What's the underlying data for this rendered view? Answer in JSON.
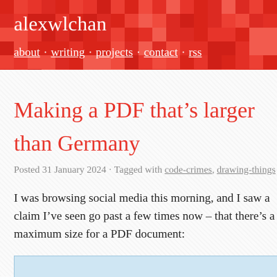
{
  "header": {
    "site_title": "alexwlchan",
    "nav": [
      {
        "label": "about"
      },
      {
        "label": "writing"
      },
      {
        "label": "projects"
      },
      {
        "label": "contact"
      },
      {
        "label": "rss"
      }
    ],
    "separator": "·",
    "accent_color": "#e7342a"
  },
  "post": {
    "title": "Making a PDF that’s larger than Germany",
    "meta": {
      "posted_prefix": "Posted",
      "date": "31 January 2024",
      "tagged_prefix": "· Tagged with",
      "tags": [
        "code-crimes",
        "drawing-things"
      ]
    },
    "intro": "I was browsing social media this morning, and I saw a claim I’ve seen go past a few times now – that there’s a maximum size for a PDF document:"
  }
}
